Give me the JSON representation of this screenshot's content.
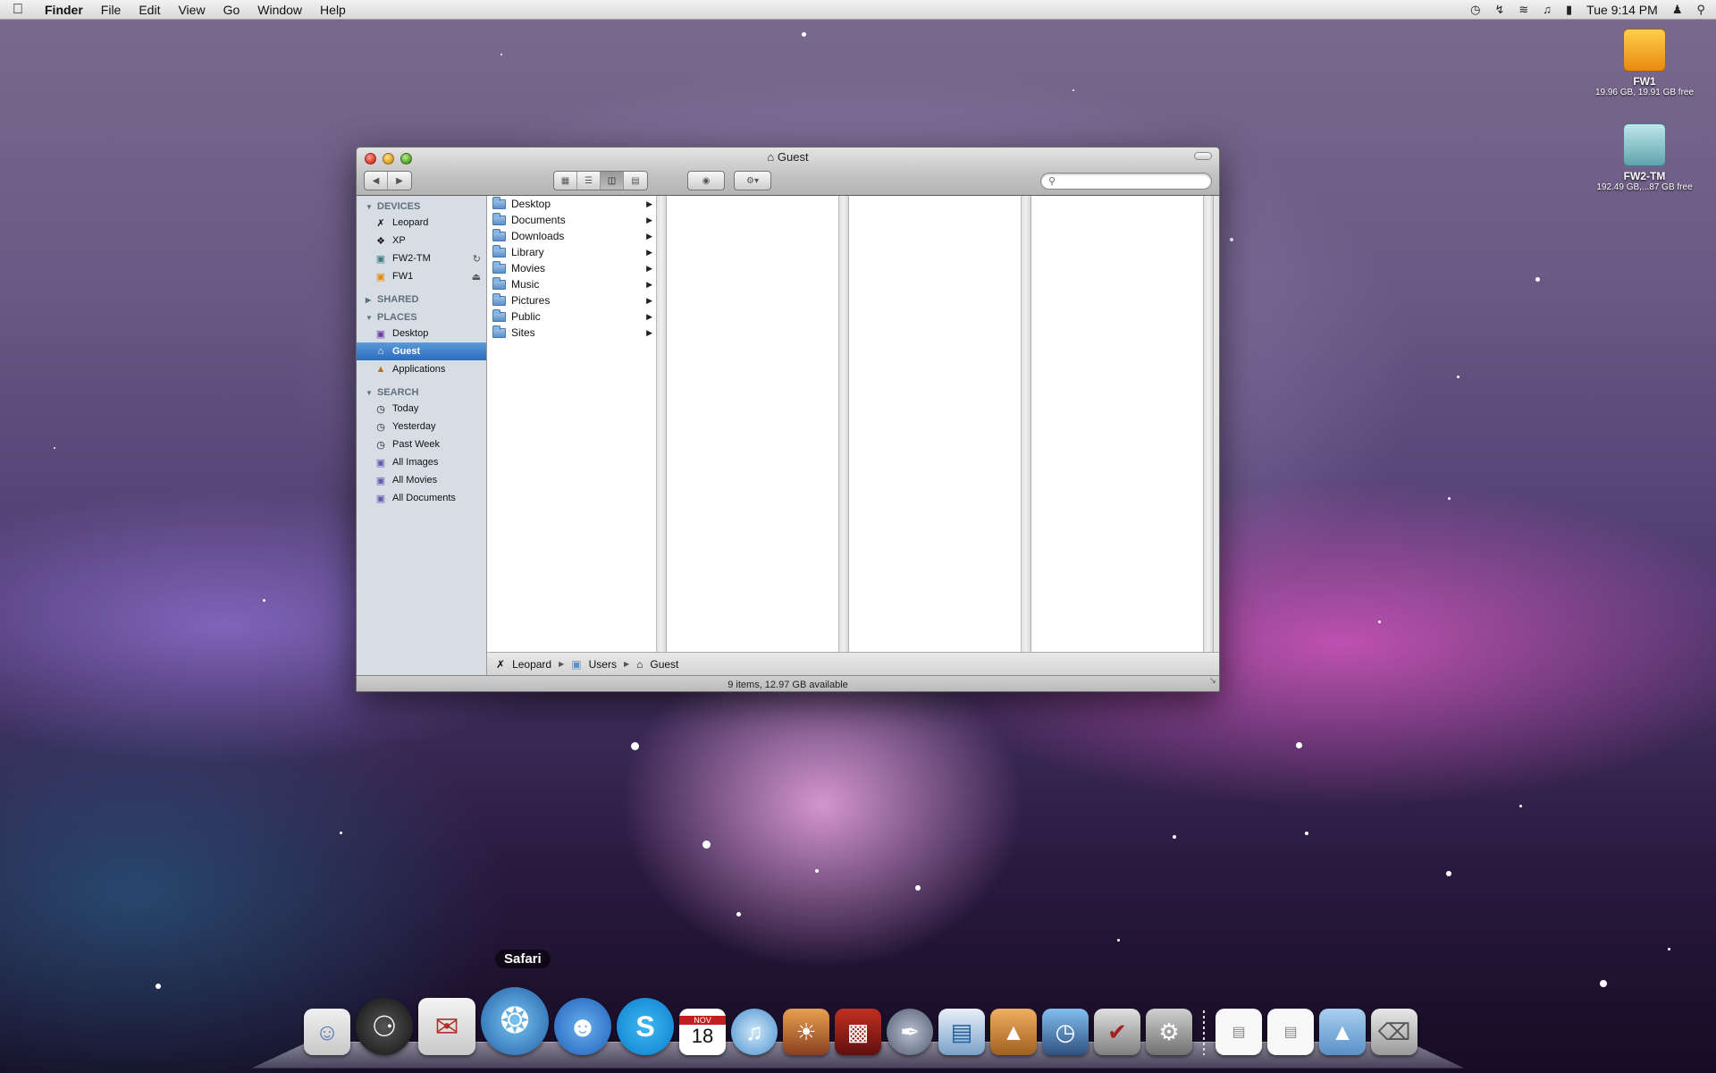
{
  "menubar": {
    "app_name": "Finder",
    "menus": [
      "File",
      "Edit",
      "View",
      "Go",
      "Window",
      "Help"
    ],
    "clock": "Tue 9:14 PM",
    "status_icons": [
      "time-machine-icon",
      "bluetooth-icon",
      "wifi-icon",
      "volume-icon",
      "battery-icon",
      "user-icon",
      "spotlight-icon"
    ]
  },
  "desktop": {
    "icons": [
      {
        "name": "FW1",
        "sub": "19.96 GB, 19.91 GB free"
      },
      {
        "name": "FW2-TM",
        "sub": "192.49 GB,...87 GB free"
      }
    ]
  },
  "window": {
    "title": "Guest",
    "sidebar": {
      "sections": [
        {
          "header": "DEVICES",
          "items": [
            "Leopard",
            "XP",
            "FW2-TM",
            "FW1"
          ]
        },
        {
          "header": "SHARED",
          "items": []
        },
        {
          "header": "PLACES",
          "items": [
            "Desktop",
            "Guest",
            "Applications"
          ]
        },
        {
          "header": "SEARCH",
          "items": [
            "Today",
            "Yesterday",
            "Past Week",
            "All Images",
            "All Movies",
            "All Documents"
          ]
        }
      ],
      "selected": "Guest"
    },
    "column1": [
      "Desktop",
      "Documents",
      "Downloads",
      "Library",
      "Movies",
      "Music",
      "Pictures",
      "Public",
      "Sites"
    ],
    "path": [
      "Leopard",
      "Users",
      "Guest"
    ],
    "status": "9 items, 12.97 GB available",
    "search_placeholder": ""
  },
  "dock": {
    "tooltip": "Safari",
    "apps": [
      "Finder",
      "Dashboard",
      "Mail",
      "Safari",
      "Adium",
      "Skype",
      "iCal",
      "iTunes",
      "iPhoto",
      "Front Row",
      "Script Editor",
      "Numbers",
      "Keynote",
      "Time Machine",
      "Preview",
      "System Preferences"
    ],
    "calendar_day": "18",
    "calendar_month": "NOV"
  }
}
